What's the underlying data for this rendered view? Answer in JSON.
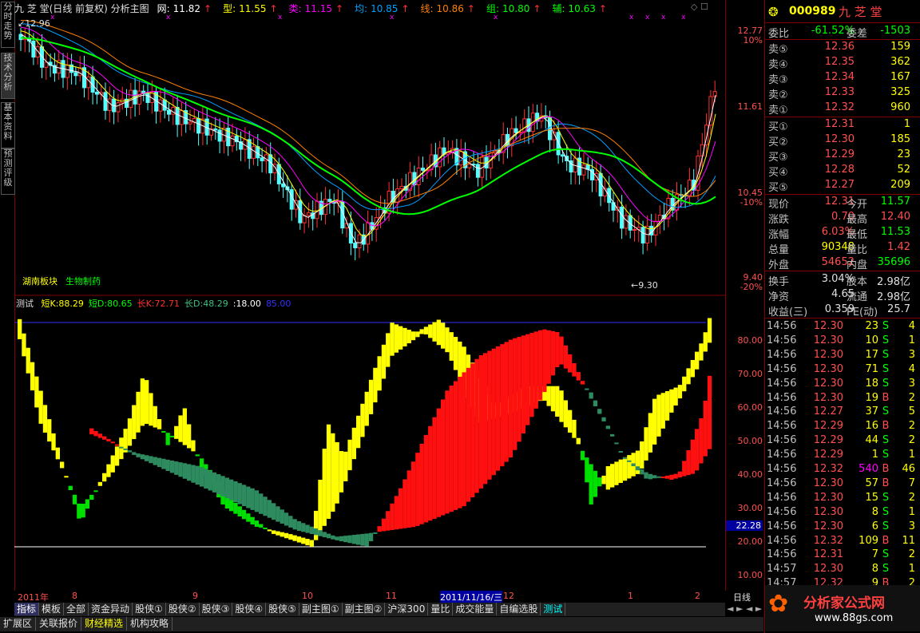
{
  "left_tabs": [
    "分时走势",
    "技术分析",
    "基本资料",
    "预测评级"
  ],
  "main_header": {
    "title": "九 芝 堂(日线 前复权) 分析主图",
    "items": [
      {
        "label": "网:",
        "value": "11.82",
        "color": "#ffffff"
      },
      {
        "label": "型:",
        "value": "11.55",
        "color": "#ffff00"
      },
      {
        "label": "类:",
        "value": "11.15",
        "color": "#ff00ff"
      },
      {
        "label": "均:",
        "value": "10.85",
        "color": "#00a0ff"
      },
      {
        "label": "线:",
        "value": "10.86",
        "color": "#ff8000"
      },
      {
        "label": "组:",
        "value": "10.80",
        "color": "#00ff00"
      },
      {
        "label": "辅:",
        "value": "10.63",
        "color": "#00ff00"
      }
    ]
  },
  "price_axis": {
    "labels": [
      "12.77",
      "10%",
      "11.61",
      "10.45",
      "-10%",
      "9.40",
      "-20%"
    ],
    "high_mark": "12.96",
    "low_mark": "9.30"
  },
  "sector_tags": {
    "tag1": "湖南板块",
    "tag2": "生物制药"
  },
  "ind_header": {
    "name": "测试",
    "items": [
      {
        "label": "短K:",
        "value": "88.29",
        "color": "#ffff00"
      },
      {
        "label": "短D:",
        "value": "80.65",
        "color": "#00ff00"
      },
      {
        "label": "长K:",
        "value": "72.71",
        "color": "#ff3030"
      },
      {
        "label": "长D:",
        "value": "48.29",
        "color": "#40c080"
      },
      {
        "label": ":",
        "value": "18.00",
        "color": "#ffffff"
      },
      {
        "label": "",
        "value": "85.00",
        "color": "#3030ff"
      }
    ]
  },
  "ind_axis": {
    "labels": [
      "80.00",
      "70.00",
      "60.00",
      "50.00",
      "40.00",
      "30.00",
      "20.00",
      "10.00"
    ],
    "current": "22.28"
  },
  "date_axis": {
    "labels": [
      "2011年",
      "8",
      "9",
      "10",
      "11",
      "2011/11/16/三",
      "12",
      "1",
      "2"
    ],
    "period": "日线"
  },
  "bottom_tabs": [
    "指标",
    "模板",
    "全部",
    "资金异动",
    "股侠①",
    "股侠②",
    "股侠③",
    "股侠④",
    "股侠⑤",
    "副主图①",
    "副主图②",
    "沪深300",
    "量比",
    "成交能量",
    "自编选股",
    "测试"
  ],
  "footer_tabs": [
    "扩展区",
    "关联报价",
    "财经精选",
    "机构攻略"
  ],
  "right": {
    "code": "000989",
    "name": "九 芝 堂",
    "weibi": {
      "label": "委比",
      "value": "-61.52%",
      "label2": "委差",
      "value2": "-1503"
    },
    "asks": [
      {
        "label": "卖⑤",
        "price": "12.36",
        "vol": "159"
      },
      {
        "label": "卖④",
        "price": "12.35",
        "vol": "362"
      },
      {
        "label": "卖③",
        "price": "12.34",
        "vol": "167"
      },
      {
        "label": "卖②",
        "price": "12.33",
        "vol": "325"
      },
      {
        "label": "卖①",
        "price": "12.32",
        "vol": "960"
      }
    ],
    "bids": [
      {
        "label": "买①",
        "price": "12.31",
        "vol": "1"
      },
      {
        "label": "买②",
        "price": "12.30",
        "vol": "185"
      },
      {
        "label": "买③",
        "price": "12.29",
        "vol": "23"
      },
      {
        "label": "买④",
        "price": "12.28",
        "vol": "52"
      },
      {
        "label": "买⑤",
        "price": "12.27",
        "vol": "209"
      }
    ],
    "stats": [
      {
        "l1": "现价",
        "v1": "12.31",
        "l2": "今开",
        "v2": "11.57",
        "c2": "#00ff00"
      },
      {
        "l1": "涨跌",
        "v1": "0.70",
        "l2": "最高",
        "v2": "12.40",
        "c2": "#ff5050"
      },
      {
        "l1": "涨幅",
        "v1": "6.03%",
        "l2": "最低",
        "v2": "11.53",
        "c2": "#00ff00"
      },
      {
        "l1": "总量",
        "v1": "90348",
        "l2": "量比",
        "v2": "1.42",
        "c2": "#ff5050"
      },
      {
        "l1": "外盘",
        "v1": "54652",
        "l2": "内盘",
        "v2": "35696",
        "c2": "#00ff00"
      }
    ],
    "fin": [
      {
        "l1": "换手",
        "v1": "3.04%",
        "l2": "股本",
        "v2": "2.98亿"
      },
      {
        "l1": "净资",
        "v1": "4.65",
        "l2": "流通",
        "v2": "2.98亿"
      },
      {
        "l1": "收益(三)",
        "v1": "0.359",
        "l2": "PE(动)",
        "v2": "25.7"
      }
    ],
    "ticks": [
      {
        "t": "14:56",
        "p": "12.30",
        "v": "23",
        "s": "S",
        "n": "4"
      },
      {
        "t": "14:56",
        "p": "12.30",
        "v": "10",
        "s": "S",
        "n": "1"
      },
      {
        "t": "14:56",
        "p": "12.30",
        "v": "17",
        "s": "S",
        "n": "3"
      },
      {
        "t": "14:56",
        "p": "12.30",
        "v": "71",
        "s": "S",
        "n": "4"
      },
      {
        "t": "14:56",
        "p": "12.30",
        "v": "18",
        "s": "S",
        "n": "3"
      },
      {
        "t": "14:56",
        "p": "12.30",
        "v": "19",
        "s": "B",
        "n": "2"
      },
      {
        "t": "14:56",
        "p": "12.27",
        "v": "37",
        "s": "S",
        "n": "5"
      },
      {
        "t": "14:56",
        "p": "12.29",
        "v": "16",
        "s": "B",
        "n": "2"
      },
      {
        "t": "14:56",
        "p": "12.29",
        "v": "44",
        "s": "S",
        "n": "2"
      },
      {
        "t": "14:56",
        "p": "12.29",
        "v": "1",
        "s": "S",
        "n": "1"
      },
      {
        "t": "14:56",
        "p": "12.32",
        "v": "540",
        "s": "B",
        "n": "46"
      },
      {
        "t": "14:56",
        "p": "12.30",
        "v": "57",
        "s": "B",
        "n": "7"
      },
      {
        "t": "14:56",
        "p": "12.30",
        "v": "15",
        "s": "S",
        "n": "2"
      },
      {
        "t": "14:56",
        "p": "12.30",
        "v": "8",
        "s": "S",
        "n": "1"
      },
      {
        "t": "14:56",
        "p": "12.30",
        "v": "6",
        "s": "S",
        "n": "3"
      },
      {
        "t": "14:56",
        "p": "12.32",
        "v": "109",
        "s": "B",
        "n": "11"
      },
      {
        "t": "14:56",
        "p": "12.31",
        "v": "7",
        "s": "S",
        "n": "2"
      },
      {
        "t": "14:57",
        "p": "12.30",
        "v": "8",
        "s": "S",
        "n": "1"
      },
      {
        "t": "14:57",
        "p": "12.32",
        "v": "9",
        "s": "B",
        "n": "2"
      }
    ],
    "watermark": "分析家公式网",
    "watermark_url": "www.88gs.com"
  }
}
